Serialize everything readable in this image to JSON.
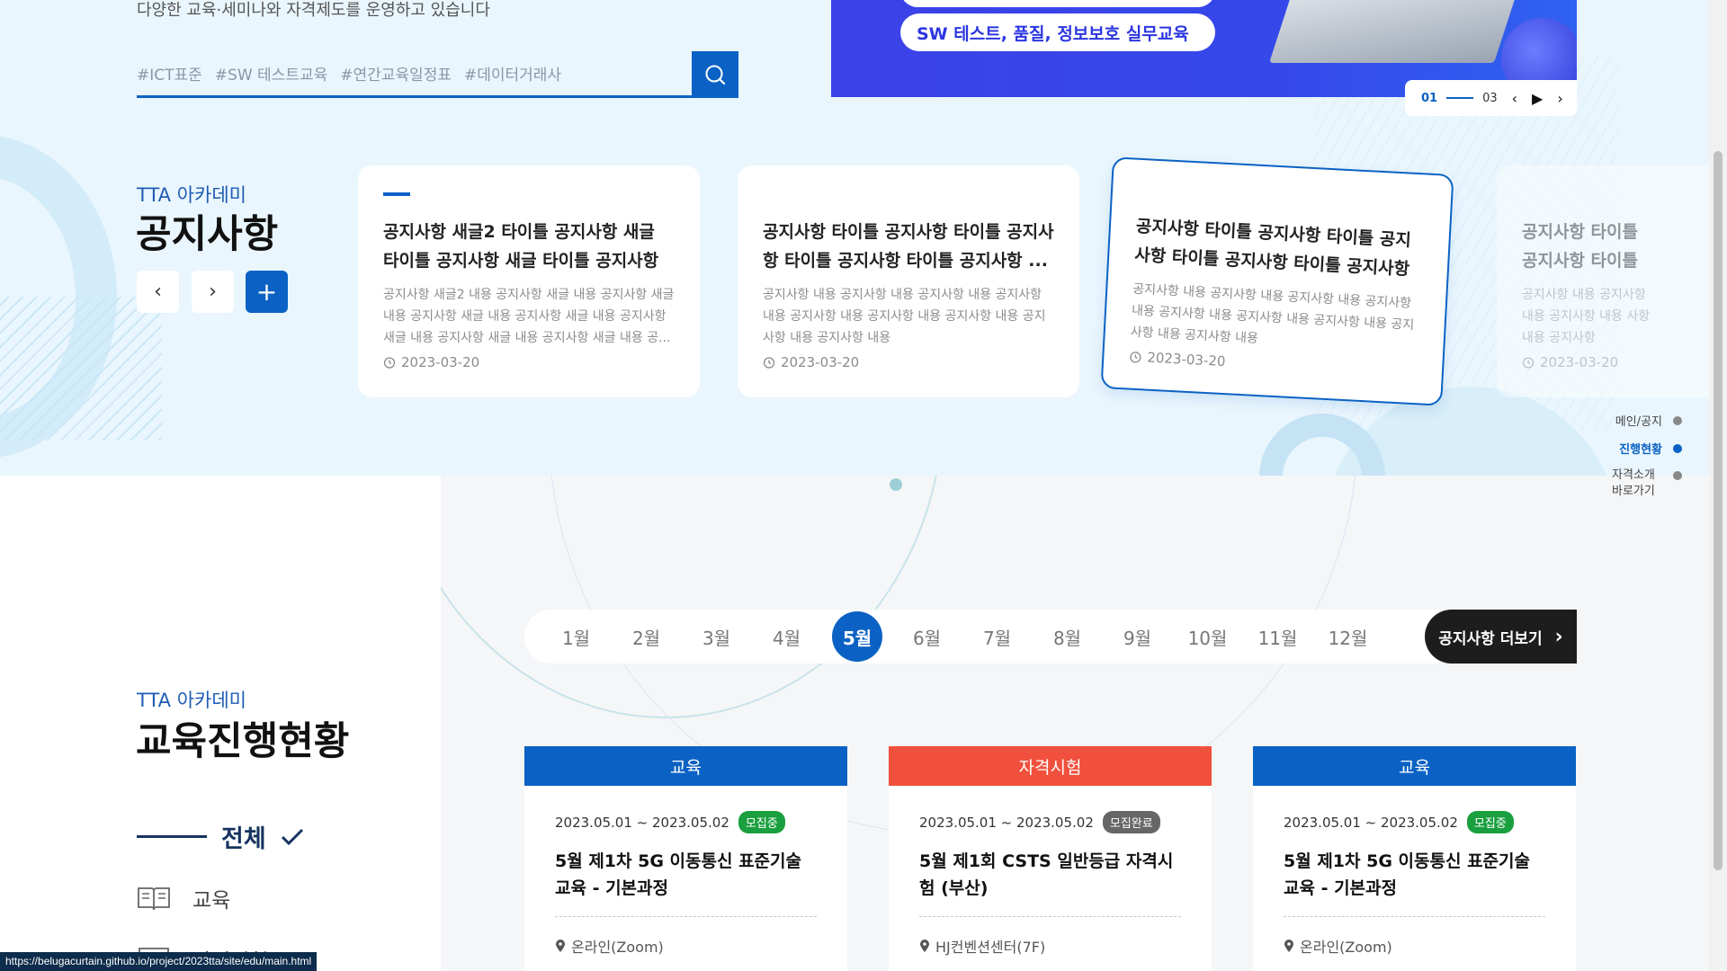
{
  "intro": "다양한 교육·세미나와 자격제도를 운영하고 있습니다",
  "tags": [
    "#ICT표준",
    "#SW 테스트교육",
    "#연간교육일정표",
    "#데이터거래사"
  ],
  "banner": {
    "pill": "SW 테스트, 품질, 정보보호 실무교육",
    "slider_current": "01",
    "slider_total": "03"
  },
  "notice": {
    "subtitle": "TTA 아카데미",
    "title": "공지사항",
    "prev": "‹",
    "next": "›",
    "plus": "+",
    "cards": [
      {
        "title": "공지사항 새글2 타이틀 공지사항 새글 타이틀 공지사항 새글 타이틀 공지사항 ...",
        "body": "공지사항 새글2 내용 공지사항 새글 내용 공지사항 새글 내용 공지사항 새글 내용 공지사항 새글 내용 공지사항 새글 내용 공지사항 새글 내용 공지사항 새글 내용 공...",
        "date": "2023-03-20"
      },
      {
        "title": "공지사항 타이틀 공지사항 타이틀 공지사항 타이틀 공지사항 타이틀 공지사항 ...",
        "body": "공지사항 내용 공지사항 내용 공지사항 내용 공지사항 내용 공지사항 내용 공지사항 내용 공지사항 내용 공지사항 내용 공지사항 내용",
        "date": "2023-03-20"
      },
      {
        "title": "공지사항 타이틀 공지사항 타이틀 공지사항 타이틀 공지사항 타이틀 공지사항 ...",
        "body": "공지사항 내용 공지사항 내용 공지사항 내용 공지사항 내용 공지사항 내용 공지사항 내용 공지사항 내용 공지사항 내용 공지사항 내용",
        "date": "2023-03-20"
      },
      {
        "title": "공지사항 타이틀 공지사항 타이틀",
        "body": "공지사항 내용 공지사항 내용 공지사항 내용 사항 내용 공지사항",
        "date": "2023-03-20"
      }
    ]
  },
  "side_nav": [
    "메인/공지",
    "진행현황",
    "자격소개 바로가기"
  ],
  "education": {
    "subtitle": "TTA 아카데미",
    "title": "교육진행현황",
    "filter_all": "전체",
    "filter_edu": "교육",
    "filter_next": "자격시험",
    "months": [
      "1월",
      "2월",
      "3월",
      "4월",
      "5월",
      "6월",
      "7월",
      "8월",
      "9월",
      "10월",
      "11월",
      "12월"
    ],
    "active_month": "5월",
    "more": "공지사항 더보기",
    "cards": [
      {
        "category": "교육",
        "color": "#0b62c4",
        "dates": "2023.05.01 ~ 2023.05.02",
        "badge": "모집중",
        "badge_color": "#1a9f3f",
        "title": "5월 제1차 5G 이동통신 표준기술 교육 - 기본과정",
        "location": "온라인(Zoom)"
      },
      {
        "category": "자격시험",
        "color": "#f0503c",
        "dates": "2023.05.01 ~ 2023.05.02",
        "badge": "모집완료",
        "badge_color": "#666666",
        "title": "5월 제1회 CSTS 일반등급 자격시험 (부산)",
        "location": "HJ컨벤션센터(7F)"
      },
      {
        "category": "교육",
        "color": "#0b62c4",
        "dates": "2023.05.01 ~ 2023.05.02",
        "badge": "모집중",
        "badge_color": "#1a9f3f",
        "title": "5월 제1차 5G 이동통신 표준기술 교육 - 기본과정",
        "location": "온라인(Zoom)"
      }
    ]
  },
  "status_url": "https://belugacurtain.github.io/project/2023tta/site/edu/main.html"
}
